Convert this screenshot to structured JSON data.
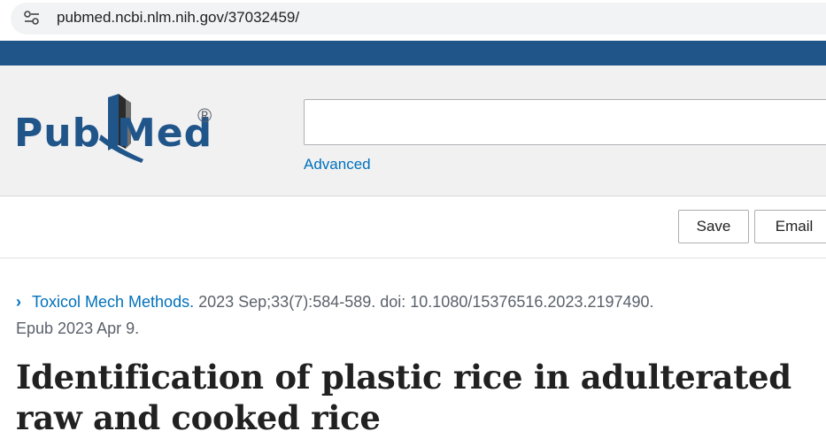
{
  "browser": {
    "url": "pubmed.ncbi.nlm.nih.gov/37032459/",
    "site_info_icon": "tune-icon"
  },
  "header": {
    "logo_text_left": "Pub",
    "logo_text_right": "Med",
    "logo_mark": "®",
    "search_value": "",
    "advanced_label": "Advanced",
    "brand_color": "#20558a"
  },
  "actions": {
    "save_label": "Save",
    "email_label": "Email"
  },
  "article": {
    "journal": "Toxicol Mech Methods.",
    "citation_details": "2023 Sep;33(7):584-589. doi: 10.1080/15376516.2023.2197490.",
    "epub": "Epub 2023 Apr 9.",
    "title": "Identification of plastic rice in adulterated raw and cooked rice"
  }
}
